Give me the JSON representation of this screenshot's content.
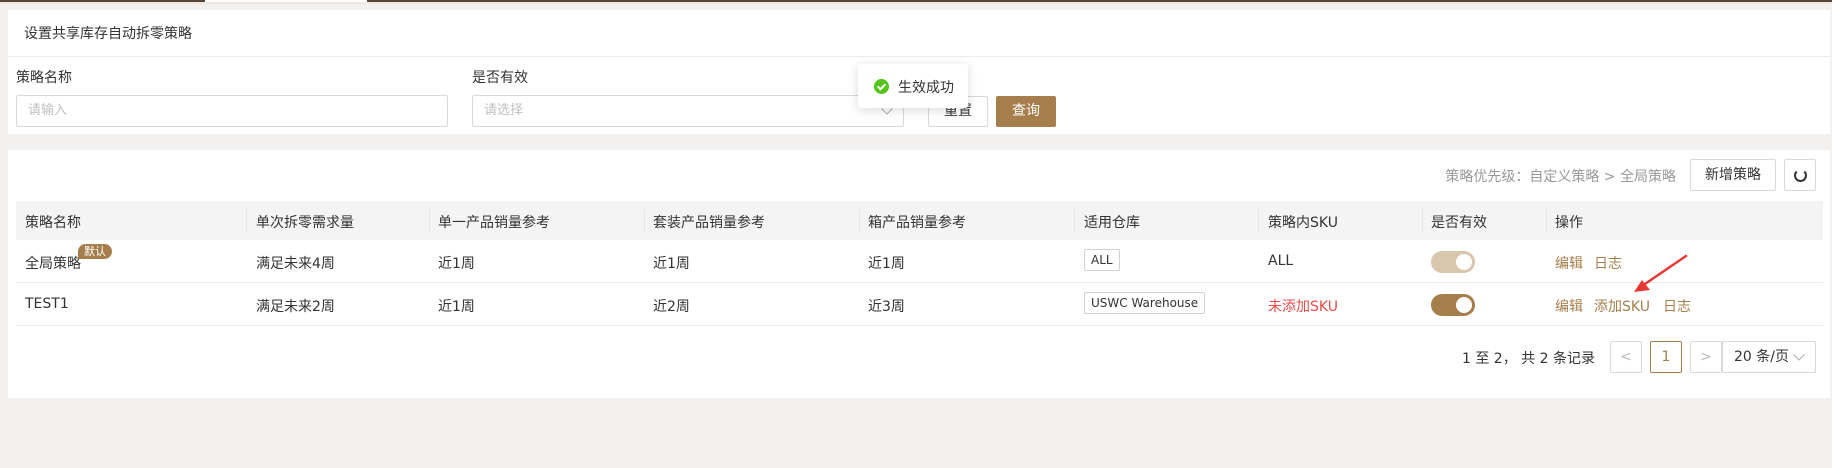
{
  "page": {
    "title": "设置共享库存自动拆零策略"
  },
  "filters": {
    "name_label": "策略名称",
    "name_placeholder": "请输入",
    "valid_label": "是否有效",
    "valid_placeholder": "请选择",
    "reset_label": "重置",
    "query_label": "查询"
  },
  "toast": {
    "text": "生效成功",
    "icon": "check-circle-icon",
    "color": "#52c41a"
  },
  "toolbar": {
    "priority_text": "策略优先级：自定义策略 > 全局策略",
    "new_label": "新增策略",
    "refresh_icon": "refresh-icon"
  },
  "table": {
    "headers": [
      "策略名称",
      "单次拆零需求量",
      "单一产品销量参考",
      "套装产品销量参考",
      "箱产品销量参考",
      "适用仓库",
      "策略内SKU",
      "是否有效",
      "操作"
    ],
    "rows": [
      {
        "name": "全局策略",
        "badge": "默认",
        "demand": "满足未来4周",
        "single": "近1周",
        "bundle": "近1周",
        "box": "近1周",
        "warehouse": "ALL",
        "sku": "ALL",
        "enabled": true,
        "toggle_disabled": true,
        "actions": [
          "编辑",
          "日志"
        ]
      },
      {
        "name": "TEST1",
        "demand": "满足未来2周",
        "single": "近1周",
        "bundle": "近2周",
        "box": "近3周",
        "warehouse": "USWC Warehouse",
        "sku": "未添加SKU",
        "enabled": true,
        "toggle_disabled": false,
        "actions": [
          "编辑",
          "添加SKU",
          "日志"
        ]
      }
    ]
  },
  "pagination": {
    "summary": "1 至 2， 共 2 条记录",
    "current_page": "1",
    "page_size": "20 条/页",
    "prev": "<",
    "next": ">"
  },
  "colors": {
    "accent": "#a57e4b",
    "danger": "#e84a4a",
    "toggle_on": "#a57e4b",
    "toggle_disabled": "#d8c6ad"
  }
}
